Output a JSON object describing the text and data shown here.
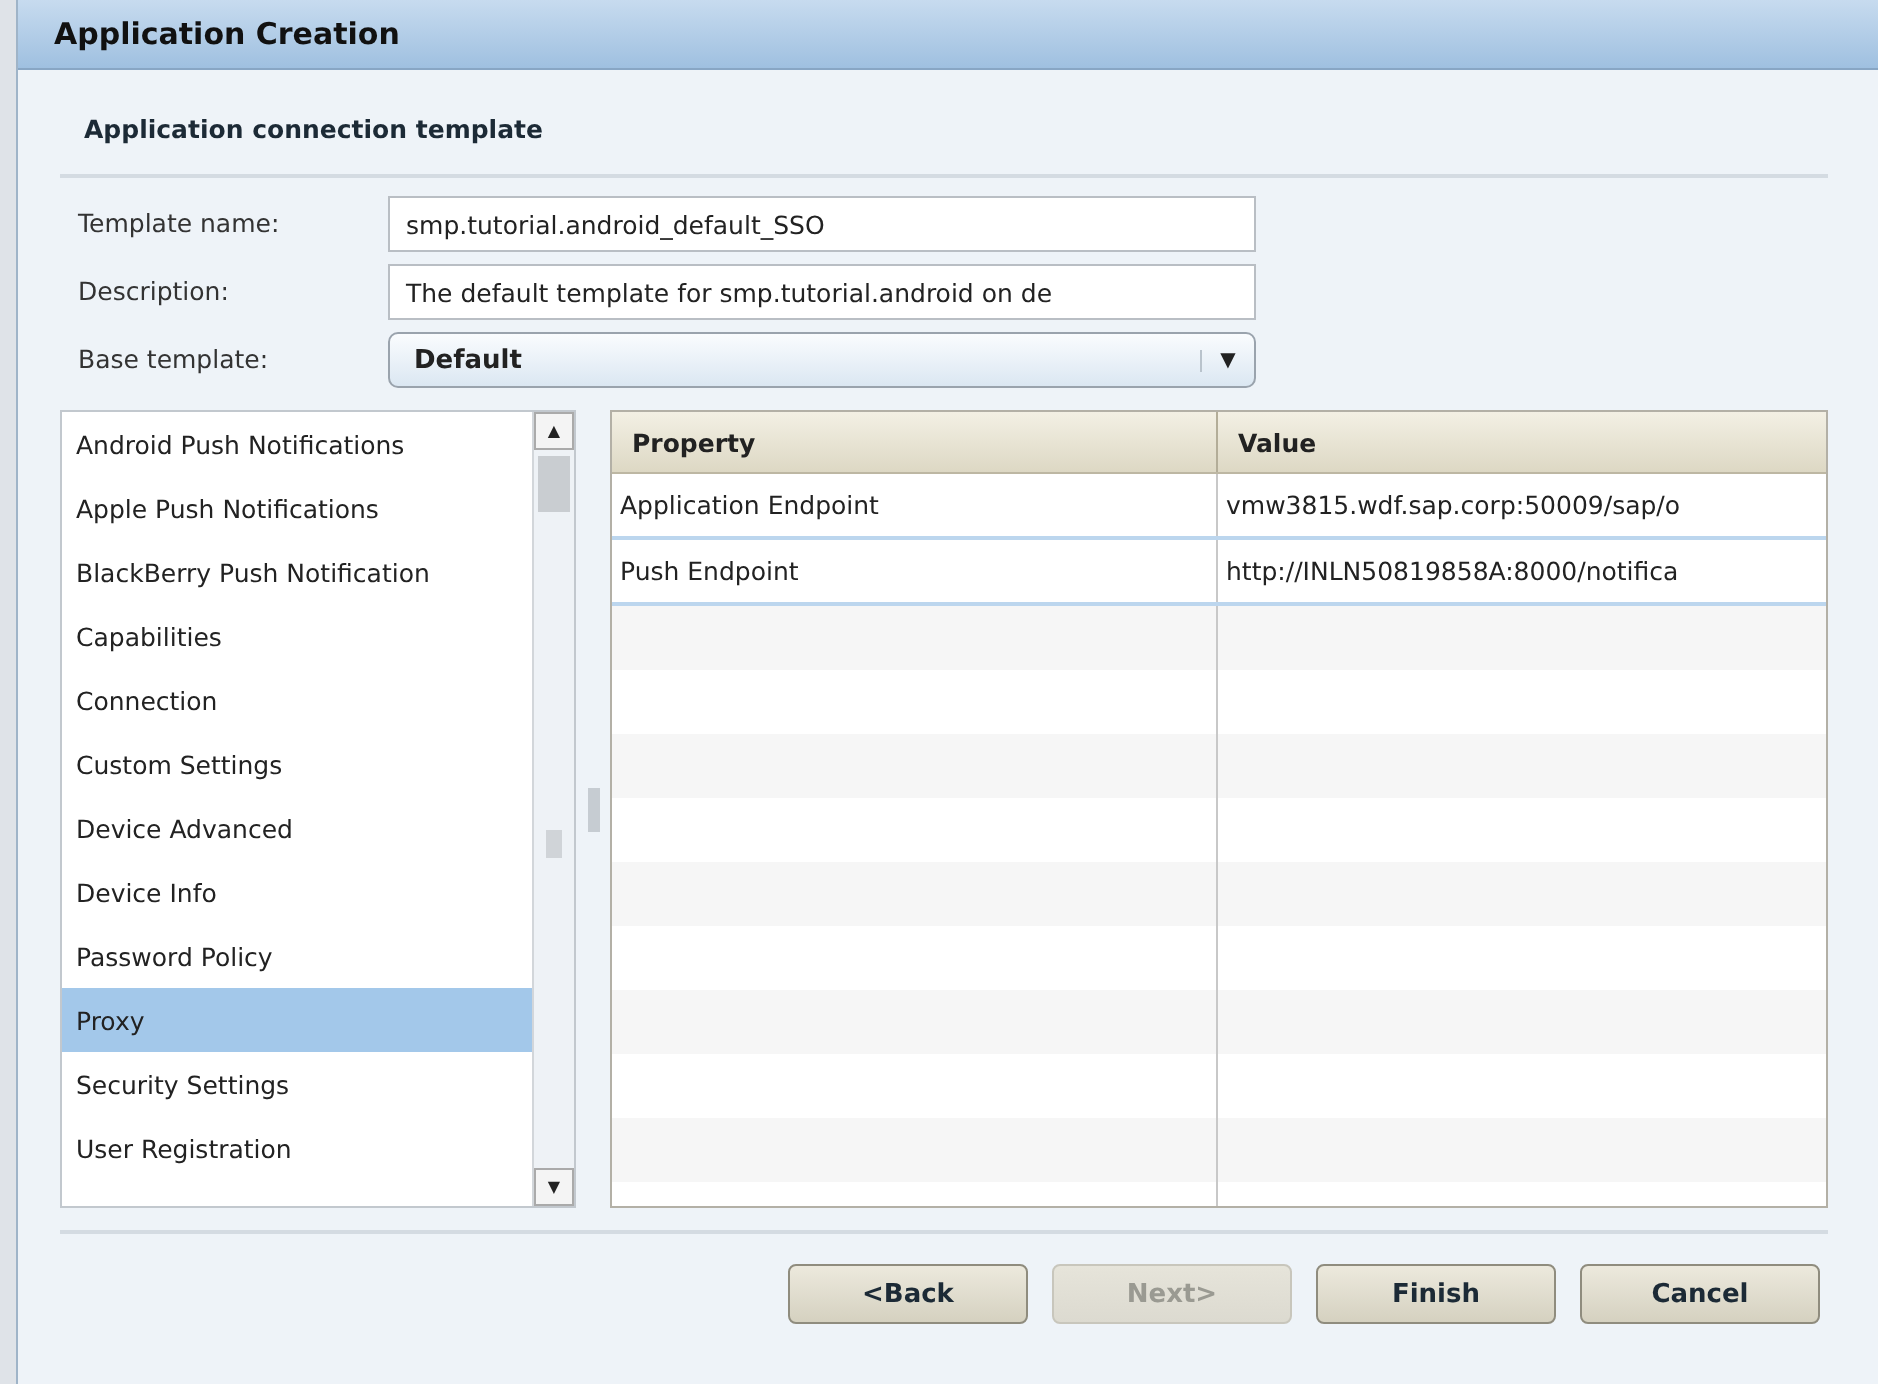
{
  "window": {
    "title": "Application Creation"
  },
  "section_title": "Application connection template",
  "form": [
    {
      "kind": "text",
      "label": "Template name:",
      "value": "smp.tutorial.android_default_SSO"
    },
    {
      "kind": "text",
      "label": "Description:",
      "value": "The default template for smp.tutorial.android on de"
    },
    {
      "kind": "dropdown",
      "label": "Base template:",
      "value": "Default",
      "caret": "▼"
    }
  ],
  "categories": {
    "scroll_up": "▲",
    "scroll_down": "▼",
    "items": [
      {
        "label": "Android Push Notifications",
        "selected": false
      },
      {
        "label": "Apple Push Notifications",
        "selected": false
      },
      {
        "label": "BlackBerry Push Notification",
        "selected": false
      },
      {
        "label": "Capabilities",
        "selected": false
      },
      {
        "label": "Connection",
        "selected": false
      },
      {
        "label": "Custom Settings",
        "selected": false
      },
      {
        "label": "Device Advanced",
        "selected": false
      },
      {
        "label": "Device Info",
        "selected": false
      },
      {
        "label": "Password Policy",
        "selected": false
      },
      {
        "label": "Proxy",
        "selected": true
      },
      {
        "label": "Security Settings",
        "selected": false
      },
      {
        "label": "User Registration",
        "selected": false
      }
    ]
  },
  "table": {
    "columns": [
      "Property",
      "Value"
    ],
    "rows": [
      [
        "Application Endpoint",
        "vmw3815.wdf.sap.corp:50009/sap/o"
      ],
      [
        "Push Endpoint",
        "http://INLN50819858A:8000/notifica"
      ]
    ]
  },
  "buttons": [
    {
      "label": "<Back",
      "disabled": false
    },
    {
      "label": "Next>",
      "disabled": true
    },
    {
      "label": "Finish",
      "disabled": false
    },
    {
      "label": "Cancel",
      "disabled": false
    }
  ]
}
